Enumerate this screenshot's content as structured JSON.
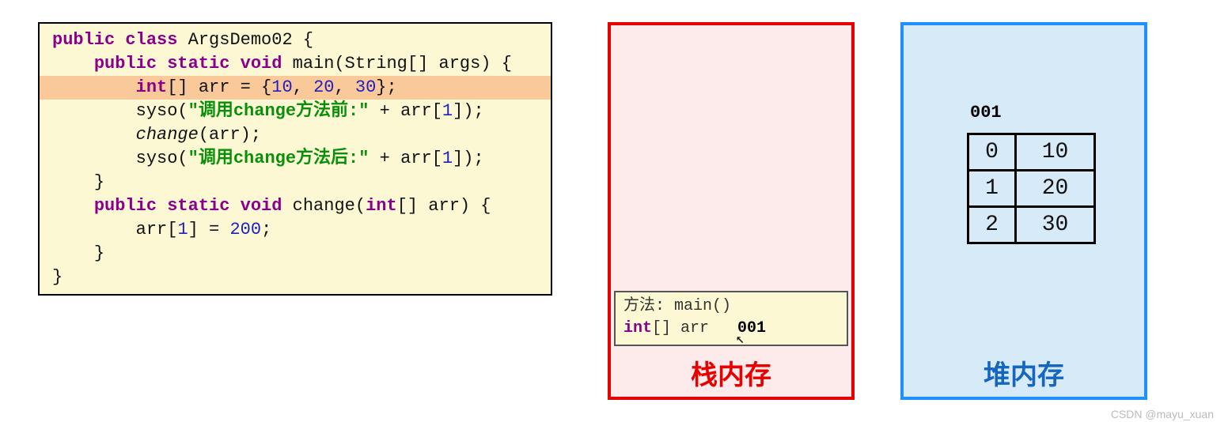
{
  "code": {
    "class_decl_kw": "public class",
    "class_name": " ArgsDemo02 {",
    "main_decl_kw": "public static void",
    "main_sig": " main(String[] args) {",
    "arr_decl_kw": "int",
    "arr_decl_mid": "[] arr = {",
    "arr_val1": "10",
    "arr_sep1": ", ",
    "arr_val2": "20",
    "arr_sep2": ", ",
    "arr_val3": "30",
    "arr_decl_end": "};",
    "syso1_a": "syso(",
    "syso1_str": "\"调用change方法前:\"",
    "syso1_b": " + arr[",
    "syso1_idx": "1",
    "syso1_c": "]);",
    "call_change_a": "change",
    "call_change_b": "(arr);",
    "syso2_a": "syso(",
    "syso2_str": "\"调用change方法后:\"",
    "syso2_b": " + arr[",
    "syso2_idx": "1",
    "syso2_c": "]);",
    "close_main": "}",
    "change_decl_kw": "public static void",
    "change_sig_a": " change(",
    "change_sig_kw": "int",
    "change_sig_b": "[] arr) {",
    "assign_a": "arr[",
    "assign_idx": "1",
    "assign_b": "] = ",
    "assign_val": "200",
    "assign_c": ";",
    "close_change": "}",
    "close_class": "}"
  },
  "stack": {
    "title": "栈内存",
    "method_label": "方法:",
    "method_name": " main()",
    "var_kw": "int",
    "var_rest": "[] arr",
    "addr": "001"
  },
  "heap": {
    "title": "堆内存",
    "addr": "001",
    "rows": [
      {
        "idx": "0",
        "val": "10"
      },
      {
        "idx": "1",
        "val": "20"
      },
      {
        "idx": "2",
        "val": "30"
      }
    ]
  },
  "watermark": "CSDN @mayu_xuan"
}
